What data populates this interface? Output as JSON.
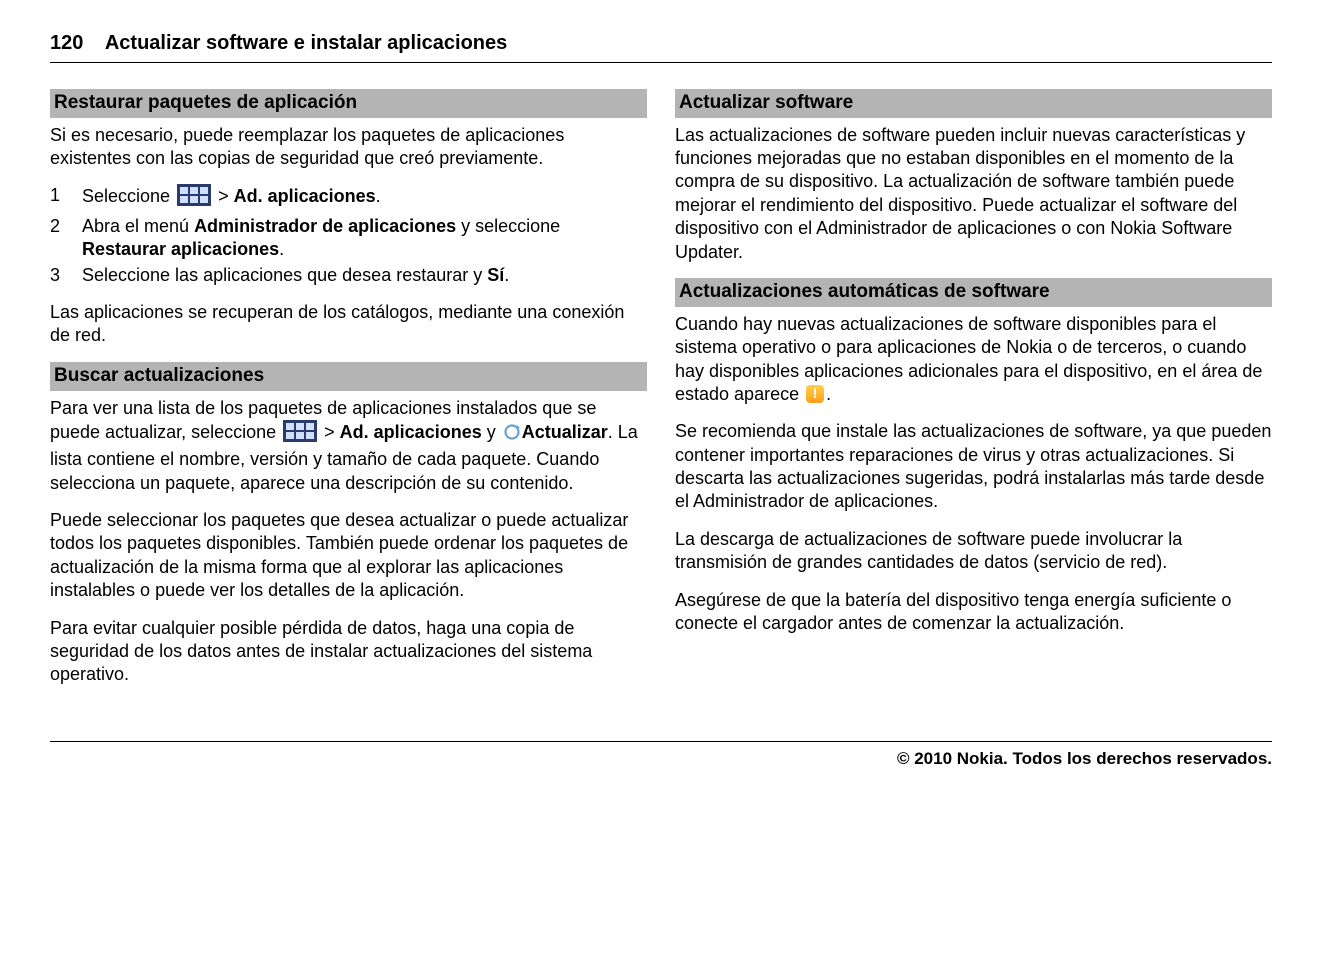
{
  "header": {
    "pageNumber": "120",
    "title": "Actualizar software e instalar aplicaciones"
  },
  "left": {
    "s1": {
      "heading": "Restaurar paquetes de aplicación",
      "p1": "Si es necesario, puede reemplazar los paquetes de aplicaciones existentes con las copias de seguridad que creó previamente.",
      "step1_pre": "Seleccione ",
      "step1_post": " > ",
      "step1_bold": "Ad. aplicaciones",
      "step1_end": ".",
      "step2_a": "Abra el menú ",
      "step2_b": "Administrador de aplicaciones",
      "step2_c": " y seleccione ",
      "step2_d": "Restaurar aplicaciones",
      "step2_e": ".",
      "step3_a": "Seleccione las aplicaciones que desea restaurar y ",
      "step3_b": "Sí",
      "step3_c": ".",
      "p2": "Las aplicaciones se recuperan de los catálogos, mediante una conexión de red."
    },
    "s2": {
      "heading": "Buscar actualizaciones",
      "p1_a": "Para ver una lista de los paquetes de aplicaciones instalados que se puede actualizar, seleccione ",
      "p1_b": " > ",
      "p1_c": "Ad. aplicaciones",
      "p1_d": " y ",
      "p1_e": "Actualizar",
      "p1_f": ". La lista contiene el nombre, versión y tamaño de cada paquete. Cuando selecciona un paquete, aparece una descripción de su contenido.",
      "p2": "Puede seleccionar los paquetes que desea actualizar o puede actualizar todos los paquetes disponibles. También puede ordenar los paquetes de actualización de la misma forma que al explorar las aplicaciones instalables o puede ver los detalles de la aplicación.",
      "p3": "Para evitar cualquier posible pérdida de datos, haga una copia de seguridad de los datos antes de instalar actualizaciones del sistema operativo."
    }
  },
  "right": {
    "s3": {
      "heading": "Actualizar software",
      "p1": "Las actualizaciones de software pueden incluir nuevas características y funciones mejoradas que no estaban disponibles en el momento de la compra de su dispositivo. La actualización de software también puede mejorar el rendimiento del dispositivo. Puede actualizar el software del dispositivo con el Administrador de aplicaciones o con Nokia Software Updater."
    },
    "s4": {
      "heading": "Actualizaciones automáticas de software",
      "p1_a": "Cuando hay nuevas actualizaciones de software disponibles para el sistema operativo o para aplicaciones de Nokia o de terceros, o cuando hay disponibles aplicaciones adicionales para el dispositivo, en el área de estado aparece ",
      "p1_b": ".",
      "p2": "Se recomienda que instale las actualizaciones de software, ya que pueden contener importantes reparaciones de virus y otras actualizaciones. Si descarta las actualizaciones sugeridas, podrá instalarlas más tarde desde el Administrador de aplicaciones.",
      "p3": "La descarga de actualizaciones de software puede involucrar la transmisión de grandes cantidades de datos (servicio de red).",
      "p4": "Asegúrese de que la batería del dispositivo tenga energía suficiente o conecte el cargador antes de comenzar la actualización."
    }
  },
  "footer": "© 2010 Nokia. Todos los derechos reservados.",
  "nums": {
    "n1": "1",
    "n2": "2",
    "n3": "3"
  }
}
